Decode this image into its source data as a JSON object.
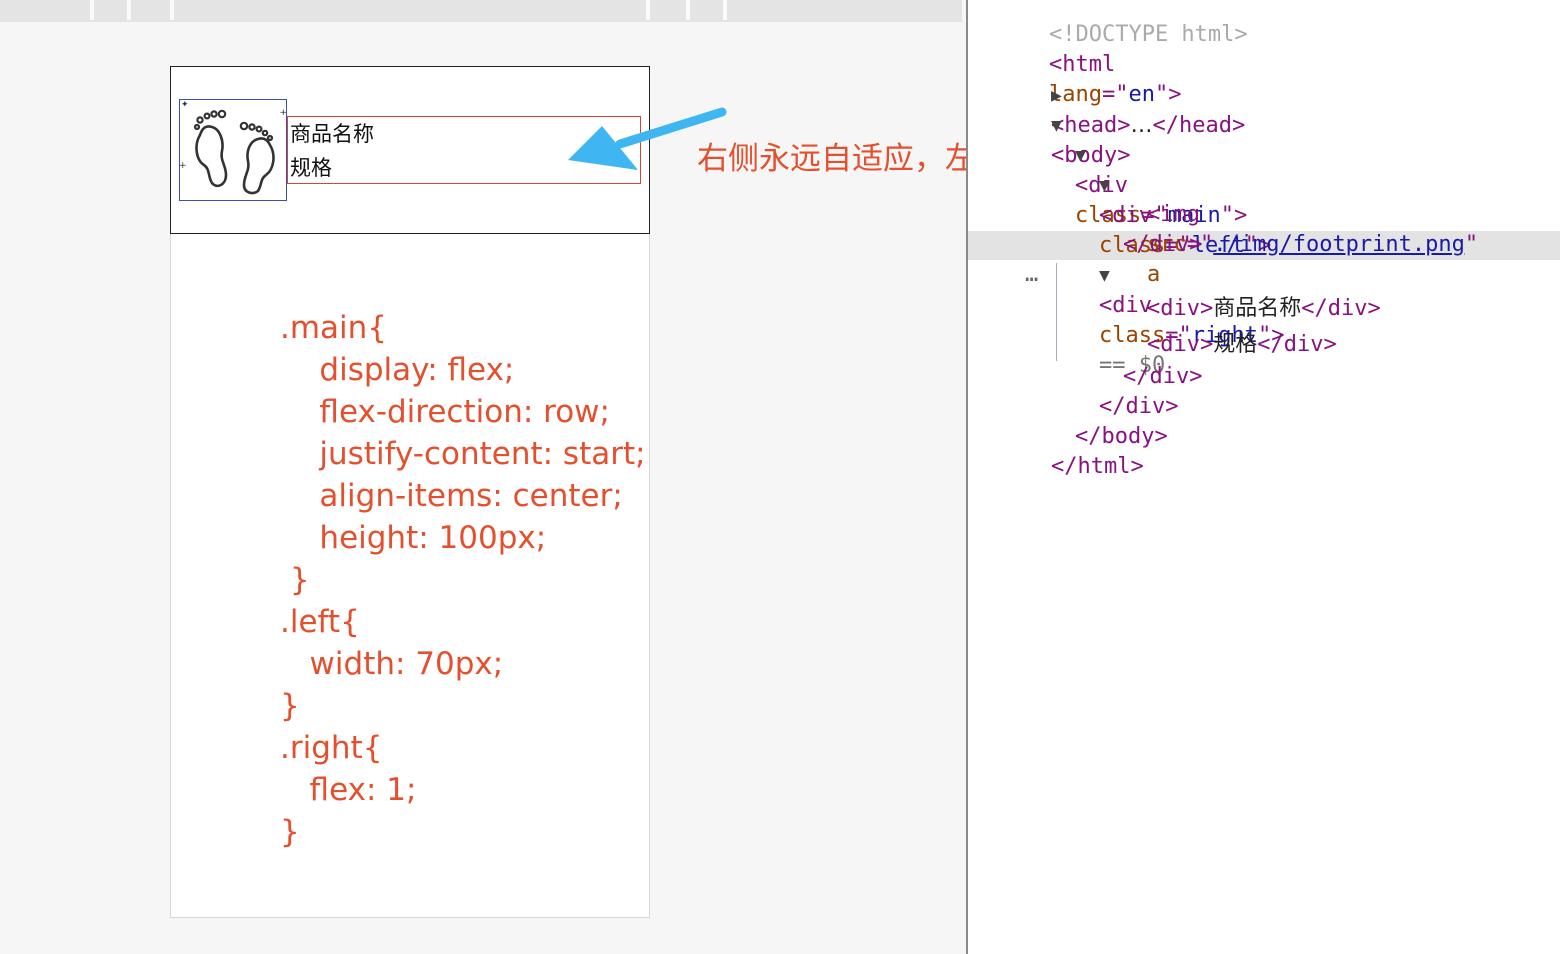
{
  "viewport": {
    "product_name": "商品名称",
    "spec": "规格",
    "annotation": "右侧永远自适应，左侧是固定的",
    "css_lines": [
      ".main{",
      "    display: flex;",
      "    flex-direction: row;",
      "    justify-content: start;",
      "    align-items: center;",
      "    height: 100px;",
      " }",
      ".left{",
      "   width: 70px;",
      "}",
      ".right{",
      "   flex: 1;",
      "}"
    ],
    "colors": {
      "annotation": "#e4502e",
      "arrow": "#3fb6f2",
      "left_outline": "#3a4fb0",
      "right_outline": "#d9443a"
    },
    "image_icon": "footprint-icon"
  },
  "devtools": {
    "doctype": "<!DOCTYPE html>",
    "html_open_tag": "html",
    "html_lang_attr": "lang",
    "html_lang_val": "en",
    "head_tag": "head",
    "head_ellipsis": "…",
    "body_tag": "body",
    "div_tag": "div",
    "class_attr": "class",
    "main_class": "main",
    "left_class": "left",
    "img_tag": "img",
    "src_attr": "src",
    "img_src": "./img/footprint.png",
    "img_trailing": "a",
    "right_class": "right",
    "selected_marker": "== $0",
    "row_ellipsis": "…",
    "child_1_text": "商品名称",
    "child_2_text": "规格"
  }
}
